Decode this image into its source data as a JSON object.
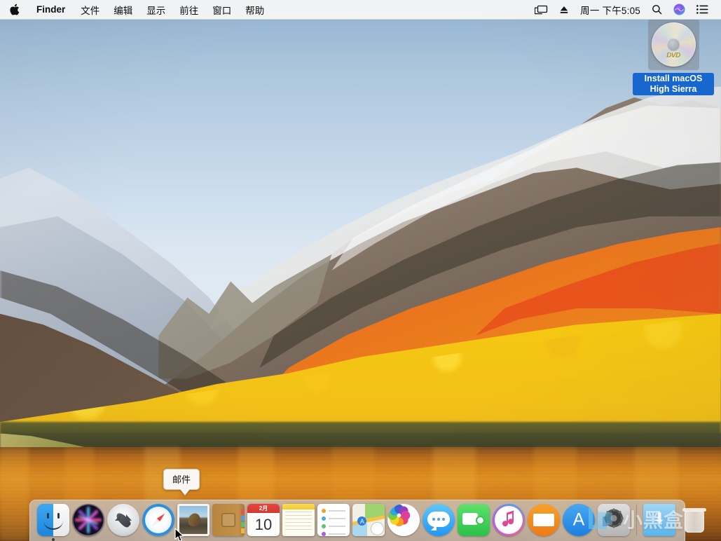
{
  "menubar": {
    "apple_icon": "apple-logo-icon",
    "app_name": "Finder",
    "items": [
      {
        "label": "文件",
        "name": "menu-file"
      },
      {
        "label": "编辑",
        "name": "menu-edit"
      },
      {
        "label": "显示",
        "name": "menu-view"
      },
      {
        "label": "前往",
        "name": "menu-go"
      },
      {
        "label": "窗口",
        "name": "menu-window"
      },
      {
        "label": "帮助",
        "name": "menu-help"
      }
    ],
    "status": {
      "screen_mirroring_icon": "screen-mirroring-icon",
      "eject_icon": "eject-icon",
      "clock": "周一 下午5:05",
      "search_icon": "spotlight-search-icon",
      "siri_icon": "siri-icon",
      "control_center_icon": "notification-center-icon"
    }
  },
  "desktop": {
    "icon": {
      "label": "Install macOS High Sierra",
      "type": "dvd-disc-image",
      "disc_text": "DVD",
      "selected": true,
      "selection_color": "#1767cf"
    }
  },
  "tooltip": {
    "label": "邮件",
    "target": "dock-item-mail"
  },
  "dock": {
    "items": [
      {
        "label": "访达",
        "name": "dock-item-finder",
        "running": true
      },
      {
        "label": "Siri",
        "name": "dock-item-siri",
        "running": false
      },
      {
        "label": "启动台",
        "name": "dock-item-launchpad",
        "running": false
      },
      {
        "label": "Safari 浏览器",
        "name": "dock-item-safari",
        "running": false
      },
      {
        "label": "邮件",
        "name": "dock-item-mail",
        "running": false
      },
      {
        "label": "通讯录",
        "name": "dock-item-contacts",
        "running": false
      },
      {
        "label": "日历",
        "name": "dock-item-calendar",
        "running": false,
        "month": "2月",
        "day": "10"
      },
      {
        "label": "备忘录",
        "name": "dock-item-notes",
        "running": false
      },
      {
        "label": "提醒事项",
        "name": "dock-item-reminders",
        "running": false
      },
      {
        "label": "地图",
        "name": "dock-item-maps",
        "running": false
      },
      {
        "label": "照片",
        "name": "dock-item-photos",
        "running": false
      },
      {
        "label": "信息",
        "name": "dock-item-messages",
        "running": false
      },
      {
        "label": "FaceTime 通话",
        "name": "dock-item-facetime",
        "running": false
      },
      {
        "label": "iTunes",
        "name": "dock-item-itunes",
        "running": false
      },
      {
        "label": "iBooks",
        "name": "dock-item-ibooks",
        "running": false
      },
      {
        "label": "App Store",
        "name": "dock-item-appstore",
        "running": false
      },
      {
        "label": "系统偏好设置",
        "name": "dock-item-system-preferences",
        "running": false
      }
    ],
    "right_items": [
      {
        "label": "下载",
        "name": "dock-item-downloads"
      },
      {
        "label": "废纸篓",
        "name": "dock-item-trash"
      }
    ]
  },
  "watermark": {
    "text": "小黑盒"
  },
  "wallpaper": {
    "name": "macOS High Sierra",
    "sky_top": "#8aaac9",
    "sky_bottom": "#dfe9f2",
    "foliage_gold": "#f8cc0c",
    "foliage_red": "#d8401a",
    "lake": "#d4821a"
  }
}
